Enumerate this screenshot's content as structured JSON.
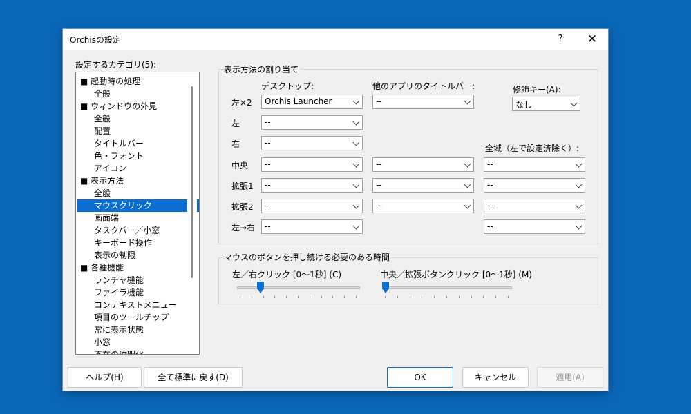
{
  "window": {
    "title": "Orchisの設定",
    "help_glyph": "?",
    "close_glyph": "✕"
  },
  "categories": {
    "label": "設定するカテゴリ(5):",
    "items": [
      {
        "text": "■ 起動時の処理",
        "level": 0
      },
      {
        "text": "全般",
        "level": 1
      },
      {
        "text": "■ ウィンドウの外見",
        "level": 0
      },
      {
        "text": "全般",
        "level": 1
      },
      {
        "text": "配置",
        "level": 1
      },
      {
        "text": "タイトルバー",
        "level": 1
      },
      {
        "text": "色・フォント",
        "level": 1
      },
      {
        "text": "アイコン",
        "level": 1
      },
      {
        "text": "■ 表示方法",
        "level": 0
      },
      {
        "text": "全般",
        "level": 1
      },
      {
        "text": "マウスクリック",
        "level": 1,
        "selected": true
      },
      {
        "text": "画面端",
        "level": 1
      },
      {
        "text": "タスクバー／小窓",
        "level": 1
      },
      {
        "text": "キーボード操作",
        "level": 1
      },
      {
        "text": "表示の制限",
        "level": 1
      },
      {
        "text": "■ 各種機能",
        "level": 0
      },
      {
        "text": "ランチャ機能",
        "level": 1
      },
      {
        "text": "ファイラ機能",
        "level": 1
      },
      {
        "text": "コンテキストメニュー",
        "level": 1
      },
      {
        "text": "項目のツールチップ",
        "level": 1
      },
      {
        "text": "常に表示状態",
        "level": 1
      },
      {
        "text": "小窓",
        "level": 1
      },
      {
        "text": "不在の透明化",
        "level": 1
      }
    ]
  },
  "assign": {
    "group_label": "表示方法の割り当て",
    "col_desktop": "デスクトップ:",
    "col_titlebar": "他のアプリのタイトルバー:",
    "modifier_label": "修飾キー(A):",
    "modifier_value": "なし",
    "global_label": "全域（左で設定済除く）:",
    "rows": [
      {
        "label": "左×2",
        "desktop": "Orchis Launcher",
        "titlebar": "--"
      },
      {
        "label": "左",
        "desktop": "--"
      },
      {
        "label": "右",
        "desktop": "--"
      },
      {
        "label": "中央",
        "desktop": "--",
        "titlebar": "--",
        "global": "--"
      },
      {
        "label": "拡張1",
        "desktop": "--",
        "titlebar": "--",
        "global": "--"
      },
      {
        "label": "拡張2",
        "desktop": "--",
        "titlebar": "--",
        "global": "--"
      },
      {
        "label": "左→右",
        "desktop": "--",
        "global": "--"
      }
    ]
  },
  "hold": {
    "group_label": "マウスのボタンを押し続ける必要のある時間",
    "left_right_label": "左／右クリック [0～1秒] (C)",
    "left_right_level": 0.17,
    "middle_label": "中央／拡張ボタンクリック [0～1秒] (M)",
    "middle_level": 0.0
  },
  "buttons": {
    "help": "ヘルプ(H)",
    "reset": "全て標準に戻す(D)",
    "ok": "OK",
    "cancel": "キャンセル",
    "apply": "適用(A)"
  },
  "colors": {
    "accent": "#0a6fd1",
    "desktop_bg": "#0a67b8"
  }
}
